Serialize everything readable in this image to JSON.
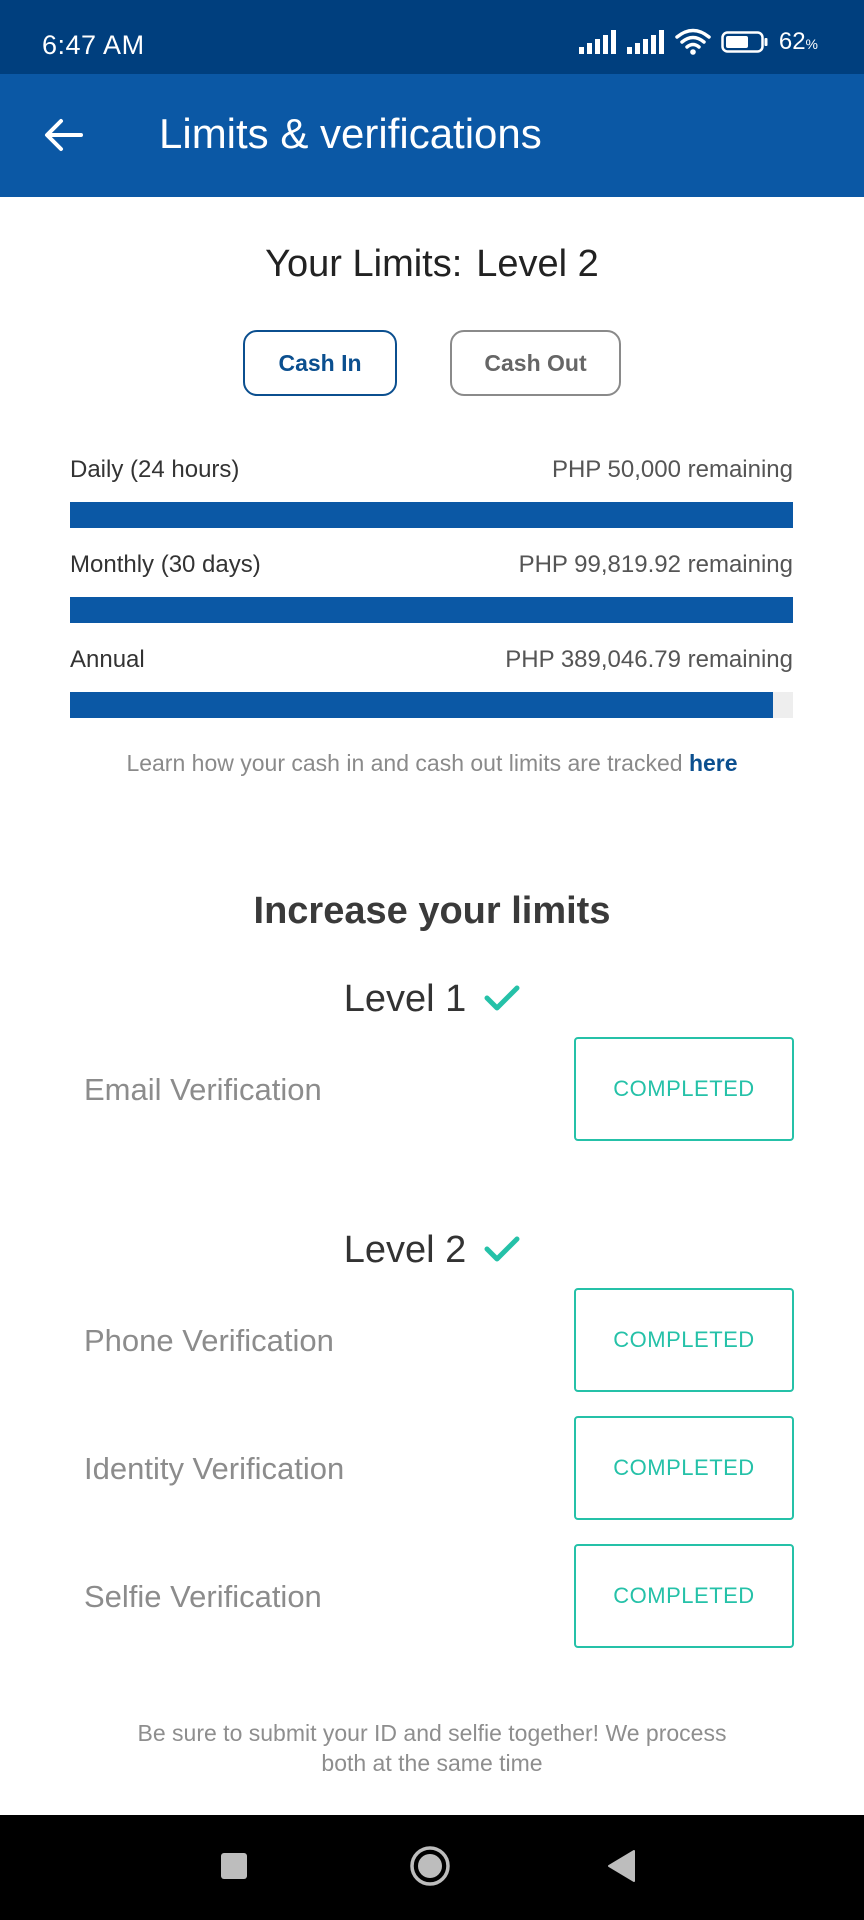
{
  "status_bar": {
    "time": "6:47 AM",
    "battery_percent": "62",
    "battery_unit": "%",
    "icons": [
      "signal-icon",
      "signal-icon",
      "wifi-icon",
      "battery-icon"
    ]
  },
  "app_bar": {
    "title": "Limits & verifications",
    "back_icon": "arrow-left-icon"
  },
  "limits": {
    "label": "Your Limits:",
    "level": "Level 2",
    "tabs": [
      {
        "label": "Cash In",
        "selected": true
      },
      {
        "label": "Cash Out",
        "selected": false
      }
    ],
    "rows": [
      {
        "name": "Daily (24 hours)",
        "remaining": "PHP 50,000 remaining",
        "fill_fraction": 1.0
      },
      {
        "name": "Monthly (30 days)",
        "remaining": "PHP 99,819.92 remaining",
        "fill_fraction": 1.0
      },
      {
        "name": "Annual",
        "remaining": "PHP 389,046.79 remaining",
        "fill_fraction": 0.973
      }
    ],
    "learn_text": "Learn how your cash in and cash out limits are tracked",
    "learn_link": "here"
  },
  "increase": {
    "title": "Increase your limits",
    "levels": [
      {
        "name": "Level 1",
        "items": [
          {
            "label": "Email Verification",
            "status": "COMPLETED"
          }
        ]
      },
      {
        "name": "Level 2",
        "items": [
          {
            "label": "Phone Verification",
            "status": "COMPLETED"
          },
          {
            "label": "Identity Verification",
            "status": "COMPLETED"
          },
          {
            "label": "Selfie Verification",
            "status": "COMPLETED"
          }
        ]
      }
    ],
    "footnote_line1": "Be sure to submit your ID and selfie together! We process",
    "footnote_line2": "both at the same time"
  },
  "nav_bar": {
    "icons": [
      "recents-square-icon",
      "home-circle-icon",
      "back-triangle-icon"
    ]
  },
  "colors": {
    "status_bar": "#003f7e",
    "app_bar": "#0b58a5",
    "progress_fill": "#0b58a5",
    "completed_accent": "#25c1a8"
  }
}
